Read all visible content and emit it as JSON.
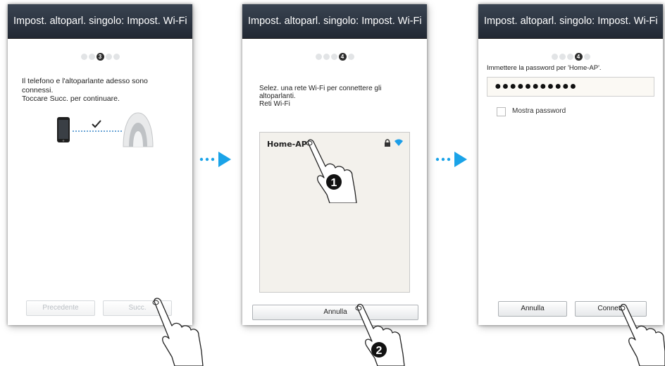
{
  "screens": [
    {
      "title": "Impost. altoparl. singolo: Impost. Wi-Fi",
      "step": "3",
      "message_lines": [
        "Il telefono e l'altoparlante adesso sono",
        "connessi.",
        "Toccare Succ. per continuare."
      ],
      "prev_label": "Precedente",
      "next_label": "Succ."
    },
    {
      "title": "Impost. altoparl. singolo: Impost. Wi-Fi",
      "step": "4",
      "message_lines": [
        "Selez. una rete Wi-Fi per connettere gli",
        "altoparlanti.",
        "Reti Wi-Fi"
      ],
      "network_name": "Home-AP",
      "cancel_label": "Annulla",
      "callout_1": "1",
      "callout_2": "2"
    },
    {
      "title": "Impost. altoparl. singolo: Impost. Wi-Fi",
      "step": "4",
      "prompt": "Immettere la password per 'Home-AP'.",
      "password_mask": "●●●●●●●●●●●",
      "show_password_label": "Mostra password",
      "cancel_label": "Annulla",
      "connect_label": "Connetti"
    }
  ],
  "colors": {
    "arrow": "#1aa3e8",
    "titlebar": "#2a313c"
  },
  "icons": [
    "smartphone-icon",
    "speaker-icon",
    "checkmark-icon",
    "lock-icon",
    "wifi-icon",
    "tap-hand-icon",
    "flow-arrow-icon"
  ]
}
